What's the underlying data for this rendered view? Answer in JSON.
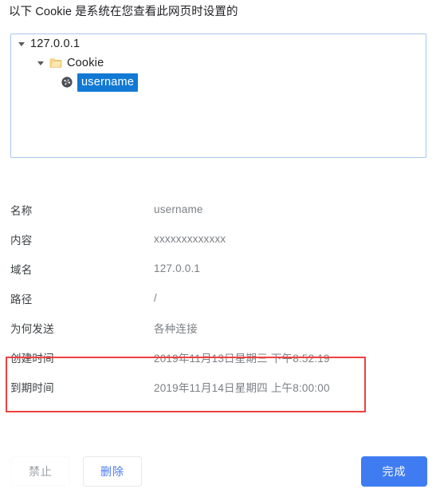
{
  "header": {
    "description": "以下 Cookie 是系统在您查看此网页时设置的"
  },
  "tree": {
    "nodes": [
      {
        "label": "127.0.0.1",
        "icon": "triangle-down-icon",
        "expanded": true,
        "selected": false
      },
      {
        "label": "Cookie",
        "icon": "folder-icon",
        "expanded": true,
        "selected": false
      },
      {
        "label": "username",
        "icon": "cookie-icon",
        "expanded": false,
        "selected": true
      }
    ]
  },
  "details": {
    "rows": [
      {
        "label": "名称",
        "value": "username"
      },
      {
        "label": "内容",
        "value": "xxxxxxxxxxxxx"
      },
      {
        "label": "域名",
        "value": "127.0.0.1"
      },
      {
        "label": "路径",
        "value": "/"
      },
      {
        "label": "为何发送",
        "value": "各种连接"
      },
      {
        "label": "创建时间",
        "value": "2019年11月13日星期三 下午8:52:19"
      },
      {
        "label": "到期时间",
        "value": "2019年11月14日星期四 上午8:00:00"
      }
    ]
  },
  "annotation": {
    "highlight_color": "#f03f3f"
  },
  "footer": {
    "block_label": "禁止",
    "delete_label": "删除",
    "done_label": "完成"
  },
  "colors": {
    "accent": "#3f7cf2",
    "selection": "#1179d3",
    "panel_border": "#a9c6e8",
    "folder": "#f5d27f",
    "value_text": "#7c8085"
  }
}
